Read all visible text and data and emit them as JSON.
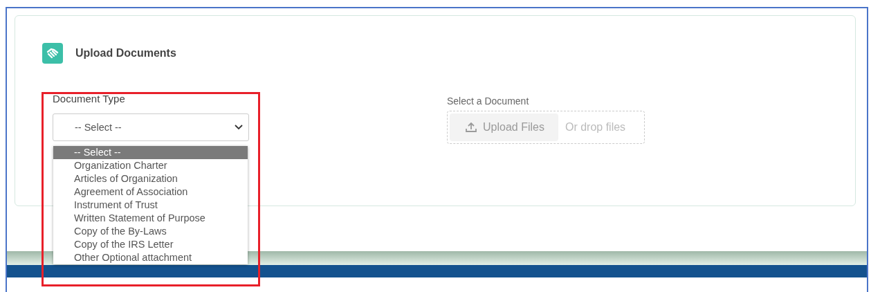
{
  "section": {
    "title": "Upload Documents"
  },
  "document_type": {
    "label": "Document Type",
    "value": "-- Select --",
    "expanded": true,
    "options": [
      {
        "label": "-- Select --",
        "selected": true
      },
      {
        "label": "Organization Charter",
        "selected": false
      },
      {
        "label": "Articles of Organization",
        "selected": false
      },
      {
        "label": "Agreement of Association",
        "selected": false
      },
      {
        "label": "Instrument of Trust",
        "selected": false
      },
      {
        "label": "Written Statement of Purpose",
        "selected": false
      },
      {
        "label": "Copy of the By-Laws",
        "selected": false
      },
      {
        "label": "Copy of the IRS Letter",
        "selected": false
      },
      {
        "label": "Other Optional attachment",
        "selected": false
      }
    ]
  },
  "document_upload": {
    "label": "Select a Document",
    "button": {
      "label": "Upload Files",
      "disabled": true
    },
    "drop_hint": "Or drop files"
  },
  "annotation": {
    "highlight": true
  }
}
